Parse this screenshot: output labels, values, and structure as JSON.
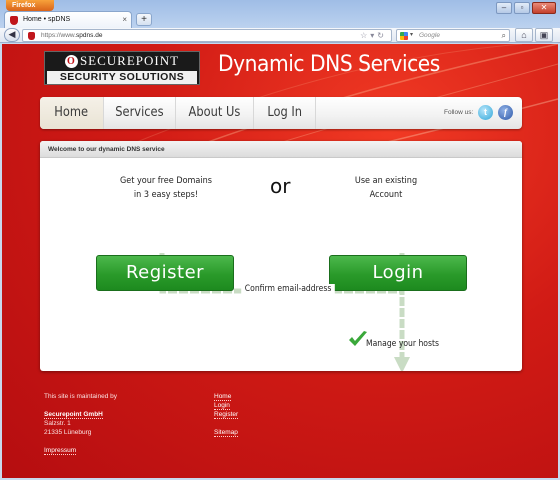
{
  "browser": {
    "app_button": "Firefox",
    "tab_title": "Home • spDNS",
    "url_prefix": "https://www.",
    "url_domain": "spdns.de",
    "search_placeholder": "Google"
  },
  "header": {
    "logo_brand": "SECUREPOINT",
    "logo_sub": "SECURITY SOLUTIONS",
    "title": "Dynamic DNS Services"
  },
  "nav": {
    "items": [
      {
        "label": "Home"
      },
      {
        "label": "Services"
      },
      {
        "label": "About Us"
      },
      {
        "label": "Log In"
      }
    ],
    "follow_label": "Follow us:"
  },
  "panel": {
    "heading": "Welcome to our dynamic DNS service",
    "register_text_1": "Get your free Domains",
    "register_text_2": "in 3 easy steps!",
    "or": "or",
    "login_text_1": "Use an existing",
    "login_text_2": "Account",
    "register_button": "Register",
    "login_button": "Login",
    "confirm_label": "Confirm email-address",
    "manage_label": "Manage your hosts"
  },
  "footer": {
    "maintained": "This site is maintained by",
    "company": "Securepoint GmbH",
    "street": "Salzstr. 1",
    "city": "21335 Lüneburg",
    "impressum": "Impressum",
    "links": [
      "Home",
      "Login",
      "Register"
    ],
    "sitemap": "Sitemap"
  },
  "colors": {
    "page_red": "#d11b15",
    "button_green": "#2a9a2a",
    "flow_green": "#c9dcc4"
  }
}
